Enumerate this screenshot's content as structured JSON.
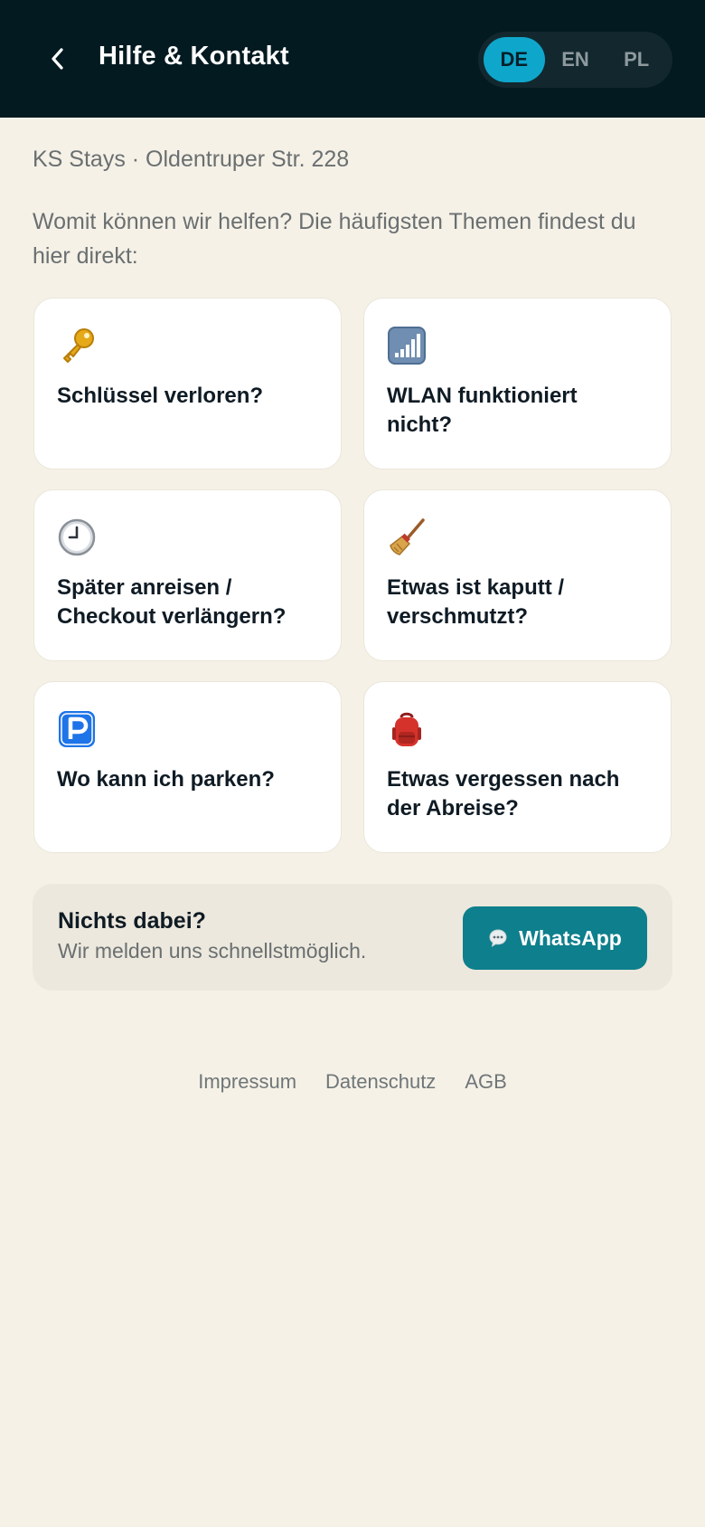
{
  "header": {
    "back_icon": "chevron-left-icon",
    "title": "Hilfe & Kontakt",
    "languages": [
      {
        "code": "DE",
        "active": true
      },
      {
        "code": "EN",
        "active": false
      },
      {
        "code": "PL",
        "active": false
      }
    ]
  },
  "property": "KS Stays · Oldentruper Str. 228",
  "intro": "Womit können wir helfen? Die häufigsten Themen findest du hier direkt:",
  "topics": [
    {
      "icon": "key-icon",
      "label": "Schlüssel verloren?"
    },
    {
      "icon": "signal-bars-icon",
      "label": "WLAN funktioniert nicht?"
    },
    {
      "icon": "clock-icon",
      "label": "Später anreisen / Checkout verlängern?"
    },
    {
      "icon": "broom-icon",
      "label": "Etwas ist kaputt / verschmutzt?"
    },
    {
      "icon": "parking-icon",
      "label": "Wo kann ich parken?"
    },
    {
      "icon": "backpack-icon",
      "label": "Etwas vergessen nach der Abreise?"
    }
  ],
  "contact": {
    "title": "Nichts dabei?",
    "subtitle": "Wir melden uns schnellstmöglich.",
    "button_label": "WhatsApp",
    "button_icon": "speech-bubble-icon"
  },
  "footer": {
    "links": [
      "Impressum",
      "Datenschutz",
      "AGB"
    ]
  },
  "colors": {
    "header_bg": "#021a20",
    "accent": "#0fa6cc",
    "whatsapp": "#0e7f8c",
    "page_bg": "#f5f1e7"
  }
}
